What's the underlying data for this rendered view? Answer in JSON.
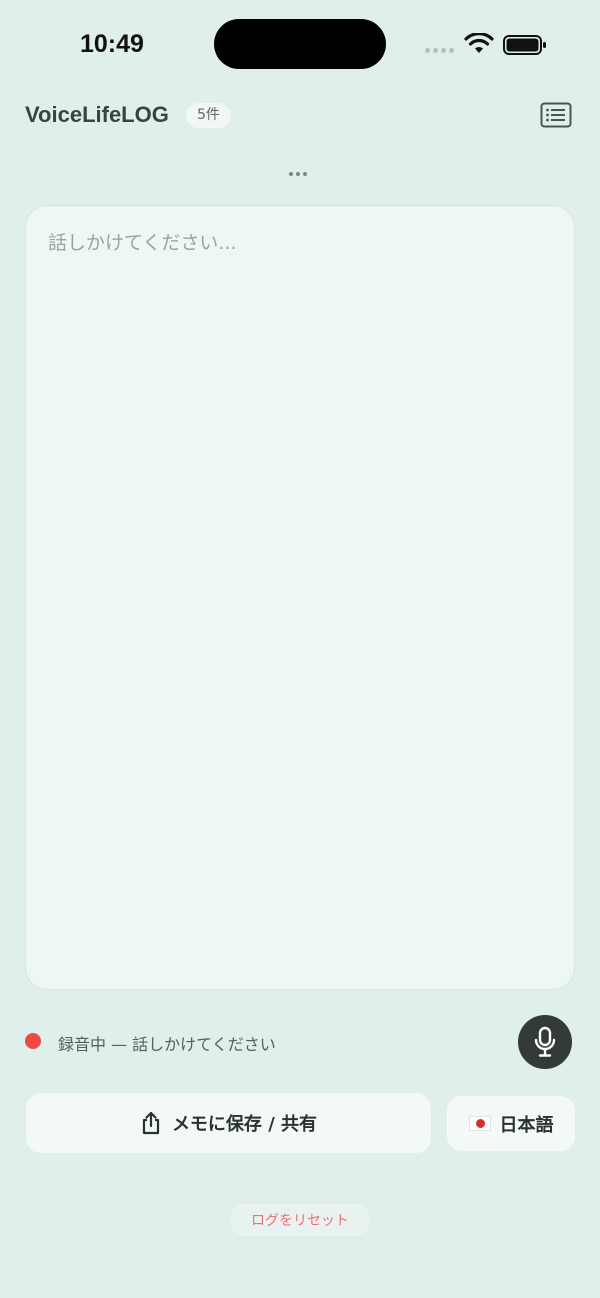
{
  "status_bar": {
    "time": "10:49"
  },
  "header": {
    "title": "VoiceLifeLOG",
    "count_badge": "5件"
  },
  "transcript": {
    "placeholder": "話しかけてください...",
    "value": ""
  },
  "recording": {
    "status_text": "録音中 — 話しかけてください"
  },
  "actions": {
    "save_label": "メモに保存 / 共有",
    "language_label": "日本語",
    "reset_label": "ログをリセット"
  },
  "colors": {
    "background": "#e0eeec",
    "recording_dot": "#f24848",
    "mic_button": "#333b39",
    "reset_text": "#f07070"
  },
  "icons": {
    "list": "list-icon",
    "share": "share-icon",
    "mic": "mic-icon",
    "flag": "japan-flag-icon"
  }
}
